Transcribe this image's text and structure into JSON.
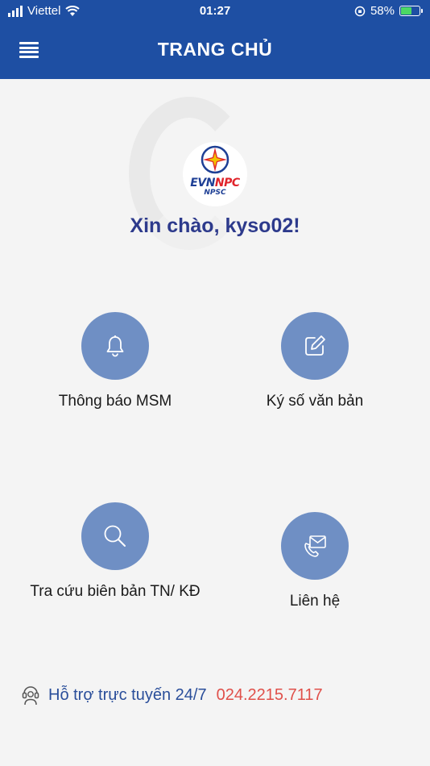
{
  "status": {
    "carrier": "Viettel",
    "time": "01:27",
    "battery": "58%",
    "battery_level": 0.58
  },
  "header": {
    "title": "TRANG CHỦ"
  },
  "logo": {
    "brand_left": "EVN",
    "brand_right": "NPC",
    "sub": "NPSC"
  },
  "greeting": "Xin chào, kyso02!",
  "menu": [
    {
      "label": "Thông báo MSM",
      "icon": "bell-icon"
    },
    {
      "label": "Ký số văn bản",
      "icon": "edit-icon"
    },
    {
      "label": "Tra cứu biên bản TN/ KĐ",
      "icon": "search-icon"
    },
    {
      "label": "Liên hệ",
      "icon": "mail-phone-icon"
    }
  ],
  "support": {
    "text": "Hỗ trợ trực tuyến 24/7",
    "phone": "024.2215.7117"
  },
  "colors": {
    "header_bg": "#1e4fa3",
    "tile_circle": "#6f8fc4",
    "greeting": "#2d3a8c",
    "phone": "#e0504a"
  }
}
